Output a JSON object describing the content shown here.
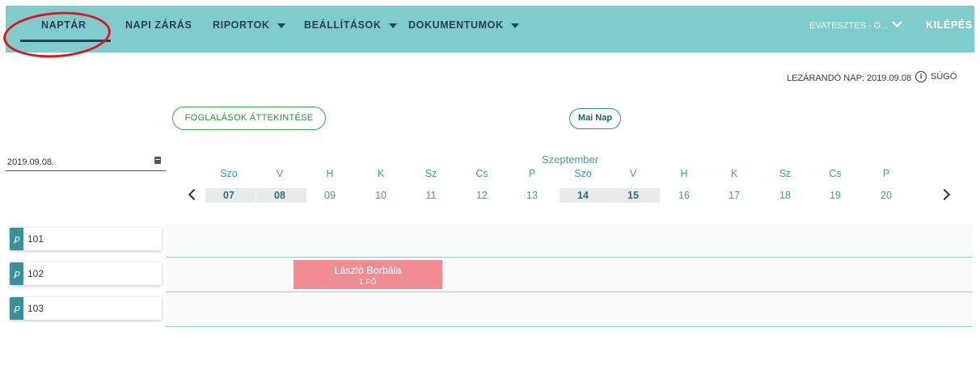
{
  "nav": {
    "calendar": "NAPTÁR",
    "daily_closing": "NAPI ZÁRÁS",
    "reports": "RIPORTOK",
    "settings": "BEÁLLÍTÁSOK",
    "documents": "DOKUMENTUMOK",
    "user": "EVATESZTES - G...",
    "logout": "KILÉPÉS"
  },
  "header": {
    "closing_day": "LEZÁRANDÓ NAP: 2019.09.08",
    "help": "SÚGÓ"
  },
  "buttons": {
    "overview": "FOGLALÁSOK ÁTTEKINTÉSE",
    "today": "Mai Nap"
  },
  "date_picker": {
    "value": "2019.09.08."
  },
  "calendar": {
    "month": "Szeptember",
    "days": [
      {
        "name": "Szo",
        "num": "07",
        "weekend": true
      },
      {
        "name": "V",
        "num": "08",
        "weekend": true
      },
      {
        "name": "H",
        "num": "09",
        "weekend": false
      },
      {
        "name": "K",
        "num": "10",
        "weekend": false
      },
      {
        "name": "Sz",
        "num": "11",
        "weekend": false
      },
      {
        "name": "Cs",
        "num": "12",
        "weekend": false
      },
      {
        "name": "P",
        "num": "13",
        "weekend": false
      },
      {
        "name": "Szo",
        "num": "14",
        "weekend": true
      },
      {
        "name": "V",
        "num": "15",
        "weekend": true
      },
      {
        "name": "H",
        "num": "16",
        "weekend": false
      },
      {
        "name": "K",
        "num": "17",
        "weekend": false
      },
      {
        "name": "Sz",
        "num": "18",
        "weekend": false
      },
      {
        "name": "Cs",
        "num": "19",
        "weekend": false
      },
      {
        "name": "P",
        "num": "20",
        "weekend": false
      }
    ]
  },
  "rooms": [
    {
      "label": "101"
    },
    {
      "label": "102"
    },
    {
      "label": "103"
    }
  ],
  "booking": {
    "guest": "László Borbála",
    "count": "1 FŐ",
    "room": "102",
    "start": "09",
    "end": "11",
    "color": "#ef8c94"
  },
  "colors": {
    "topbar": "#7fcccc",
    "accent": "#3f9ba3",
    "highlight_ring": "#e0151b"
  },
  "icons": {
    "key": "key-icon",
    "calendar": "calendar-icon",
    "info": "info-icon"
  }
}
